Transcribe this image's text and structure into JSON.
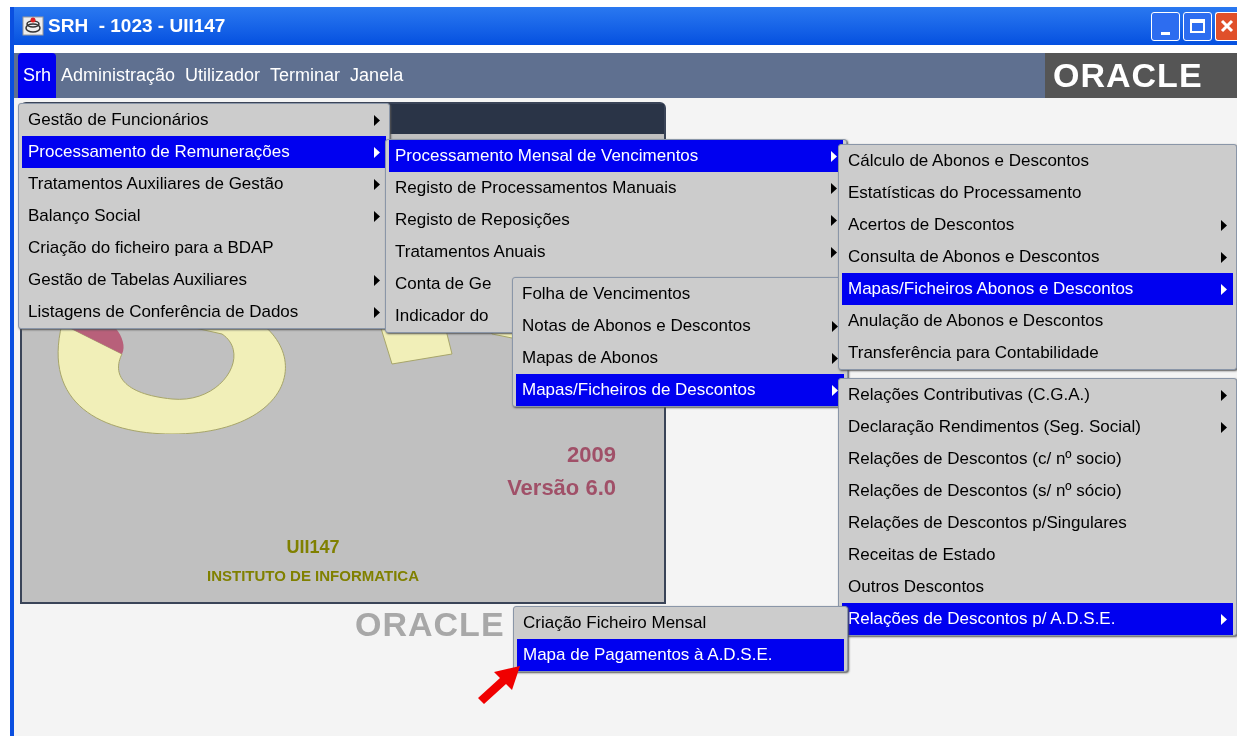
{
  "window": {
    "title": "SRH  - 1023 - UII147"
  },
  "menubar": [
    {
      "label": "Srh",
      "selected": true
    },
    {
      "label": "Administração",
      "selected": false
    },
    {
      "label": "Utilizador",
      "selected": false
    },
    {
      "label": "Terminar",
      "selected": false
    },
    {
      "label": "Janela",
      "selected": false
    }
  ],
  "brand": "ORACLE",
  "splash": {
    "year": "2009",
    "version": "Versão 6.0",
    "code": "UII147",
    "institute": "INSTITUTO DE INFORMATICA"
  },
  "background_logo": "ORACLE",
  "menus": [
    {
      "items": [
        {
          "label": "Gestão de Funcionários",
          "submenu": true,
          "selected": false
        },
        {
          "label": "Processamento de Remunerações",
          "submenu": true,
          "selected": true
        },
        {
          "label": "Tratamentos Auxiliares de Gestão",
          "submenu": true,
          "selected": false
        },
        {
          "label": "Balanço Social",
          "submenu": true,
          "selected": false
        },
        {
          "label": "Criação do ficheiro para a BDAP",
          "submenu": false,
          "selected": false
        },
        {
          "label": "Gestão de Tabelas Auxiliares",
          "submenu": true,
          "selected": false
        },
        {
          "label": "Listagens de Conferência de Dados",
          "submenu": true,
          "selected": false
        }
      ]
    },
    {
      "items": [
        {
          "label": "Processamento Mensal de Vencimentos",
          "submenu": true,
          "selected": true
        },
        {
          "label": "Registo de Processamentos Manuais",
          "submenu": true,
          "selected": false
        },
        {
          "label": "Registo de Reposições",
          "submenu": true,
          "selected": false
        },
        {
          "label": "Tratamentos Anuais",
          "submenu": true,
          "selected": false
        },
        {
          "label": "Conta de Ge",
          "submenu": false,
          "selected": false
        },
        {
          "label": "Indicador do",
          "submenu": false,
          "selected": false
        }
      ]
    },
    {
      "items": [
        {
          "label": "Folha de Vencimentos",
          "submenu": false,
          "selected": false
        },
        {
          "label": "Notas de Abonos e Descontos",
          "submenu": true,
          "selected": false
        },
        {
          "label": "Mapas de Abonos",
          "submenu": true,
          "selected": false
        },
        {
          "label": "Mapas/Ficheiros de Descontos",
          "submenu": true,
          "selected": true
        }
      ]
    },
    {
      "items": [
        {
          "label": "Cálculo de Abonos e Descontos",
          "submenu": false,
          "selected": false
        },
        {
          "label": "Estatísticas do Processamento",
          "submenu": false,
          "selected": false
        },
        {
          "label": "Acertos de Descontos",
          "submenu": true,
          "selected": false
        },
        {
          "label": "Consulta de Abonos e Descontos",
          "submenu": true,
          "selected": false
        },
        {
          "label": "Mapas/Ficheiros Abonos e Descontos",
          "submenu": true,
          "selected": true
        },
        {
          "label": "Anulação de Abonos e Descontos",
          "submenu": false,
          "selected": false
        },
        {
          "label": "Transferência para Contabilidade",
          "submenu": false,
          "selected": false
        }
      ]
    },
    {
      "items": [
        {
          "label": "Relações Contributivas (C.G.A.)",
          "submenu": true,
          "selected": false
        },
        {
          "label": "Declaração Rendimentos (Seg. Social)",
          "submenu": true,
          "selected": false
        },
        {
          "label": "Relações de Descontos (c/ nº socio)",
          "submenu": false,
          "selected": false
        },
        {
          "label": "Relações de Descontos (s/ nº sócio)",
          "submenu": false,
          "selected": false
        },
        {
          "label": "Relações de Descontos p/Singulares",
          "submenu": false,
          "selected": false
        },
        {
          "label": "Receitas de Estado",
          "submenu": false,
          "selected": false
        },
        {
          "label": "Outros Descontos",
          "submenu": false,
          "selected": false
        },
        {
          "label": "Relações de Descontos p/ A.D.S.E.",
          "submenu": true,
          "selected": true
        }
      ]
    },
    {
      "items": [
        {
          "label": "Criação Ficheiro Mensal",
          "submenu": false,
          "selected": false
        },
        {
          "label": "Mapa de Pagamentos à A.D.S.E.",
          "submenu": false,
          "selected": true
        }
      ]
    }
  ]
}
